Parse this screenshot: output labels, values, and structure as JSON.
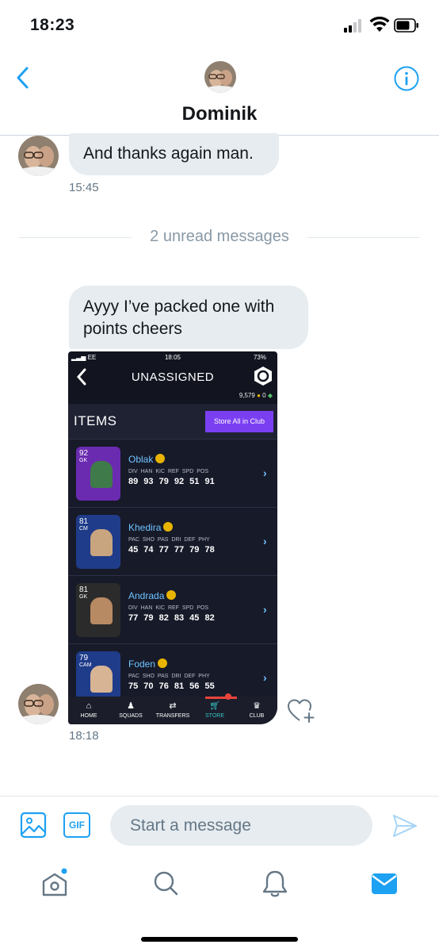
{
  "status_bar": {
    "time": "18:23"
  },
  "header": {
    "contact_name": "Dominik",
    "back_icon": "chevron-left-icon",
    "info_icon": "info-circle-icon"
  },
  "messages": [
    {
      "text": "And thanks again man.",
      "time": "15:45"
    },
    {
      "text": "Ayyy I’ve packed one with points cheers",
      "time": "18:18"
    }
  ],
  "unread_divider": "2 unread messages",
  "attachment": {
    "status": {
      "carrier": "EE",
      "time": "18:05",
      "battery": "73%"
    },
    "title": "UNASSIGNED",
    "coins": "9,579",
    "points": "0",
    "items_label": "ITEMS",
    "store_all_label": "Store All in Club",
    "players": [
      {
        "name": "Oblak",
        "rating": "92",
        "position": "GK",
        "stat_headers": "DIV HAN KIC REF SPD POS",
        "stats": "89 93 79 92 51 91",
        "card_color": "#6a2bb0"
      },
      {
        "name": "Khedira",
        "rating": "81",
        "position": "CM",
        "stat_headers": "PAC SHO PAS DRI DEF PHY",
        "stats": "45 74 77 77 79 78",
        "card_color": "#1f3c8a"
      },
      {
        "name": "Andrada",
        "rating": "81",
        "position": "GK",
        "stat_headers": "DIV HAN KIC REF SPD POS",
        "stats": "77 79 82 83 45 82",
        "card_color": "#2b2b2b"
      },
      {
        "name": "Foden",
        "rating": "79",
        "position": "CAM",
        "stat_headers": "PAC SHO PAS DRI DEF PHY",
        "stats": "75 70 76 81 56 55",
        "card_color": "#1f3c8a"
      }
    ],
    "nav": [
      "HOME",
      "SQUADS",
      "TRANSFERS",
      "STORE",
      "CLUB"
    ]
  },
  "composer": {
    "placeholder": "Start a message"
  },
  "colors": {
    "accent": "#1da1f2",
    "bubble": "#e6ecf0",
    "store_button": "#7b3ff2"
  }
}
